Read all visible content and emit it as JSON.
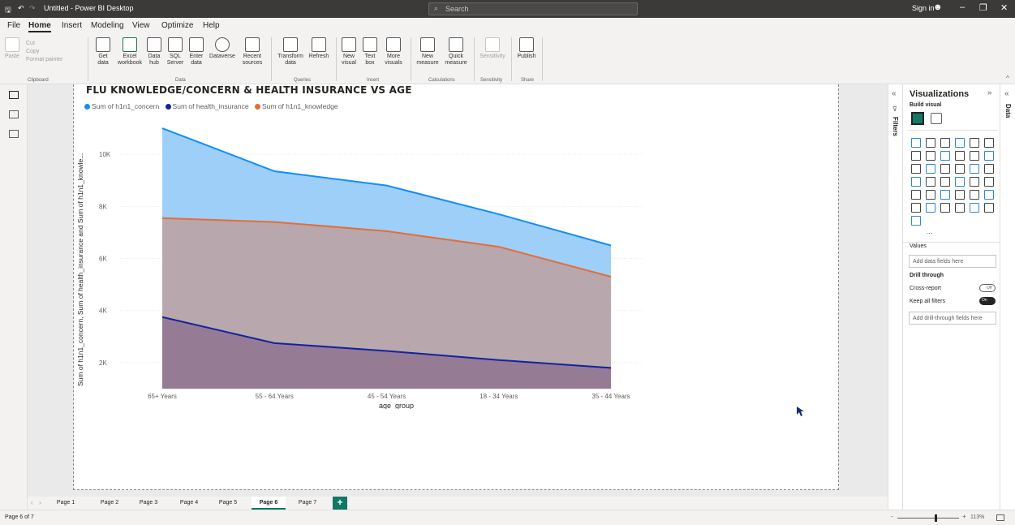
{
  "app": {
    "title": "Untitled - Power BI Desktop",
    "search_placeholder": "Search",
    "sign_in": "Sign in"
  },
  "menu": {
    "items": [
      "File",
      "Home",
      "Insert",
      "Modeling",
      "View",
      "Optimize",
      "Help"
    ],
    "active": "Home"
  },
  "ribbon": {
    "clipboard": {
      "paste": "Paste",
      "cut": "Cut",
      "copy": "Copy",
      "format_painter": "Format painter",
      "group": "Clipboard"
    },
    "data": {
      "buttons": [
        {
          "line1": "Get",
          "line2": "data"
        },
        {
          "line1": "Excel",
          "line2": "workbook"
        },
        {
          "line1": "Data",
          "line2": "hub"
        },
        {
          "line1": "SQL",
          "line2": "Server"
        },
        {
          "line1": "Enter",
          "line2": "data"
        },
        {
          "line1": "Dataverse",
          "line2": ""
        },
        {
          "line1": "Recent",
          "line2": "sources"
        }
      ],
      "group": "Data"
    },
    "queries": {
      "buttons": [
        {
          "line1": "Transform",
          "line2": "data"
        },
        {
          "line1": "Refresh",
          "line2": ""
        }
      ],
      "group": "Queries"
    },
    "insert": {
      "buttons": [
        {
          "line1": "New",
          "line2": "visual"
        },
        {
          "line1": "Text",
          "line2": "box"
        },
        {
          "line1": "More",
          "line2": "visuals"
        }
      ],
      "group": "Insert"
    },
    "calculations": {
      "buttons": [
        {
          "line1": "New",
          "line2": "measure"
        },
        {
          "line1": "Quick",
          "line2": "measure"
        }
      ],
      "group": "Calculations"
    },
    "sensitivity": {
      "buttons": [
        {
          "line1": "Sensitivity",
          "line2": ""
        }
      ],
      "group": "Sensitivity"
    },
    "share": {
      "buttons": [
        {
          "line1": "Publish",
          "line2": ""
        }
      ],
      "group": "Share"
    }
  },
  "panes": {
    "filters_label": "Filters",
    "data_label": "Data",
    "visualizations_title": "Visualizations",
    "build_visual": "Build visual",
    "values_label": "Values",
    "values_placeholder": "Add data fields here",
    "drill_through_label": "Drill through",
    "cross_report_label": "Cross-report",
    "cross_report_state": "Off",
    "keep_all_filters_label": "Keep all filters",
    "keep_all_filters_state": "On",
    "drill_placeholder": "Add drill-through fields here",
    "more_visuals": "···"
  },
  "pages": {
    "tabs": [
      "Page 1",
      "Page 2",
      "Page 3",
      "Page 4",
      "Page 5",
      "Page 6",
      "Page 7"
    ],
    "active": "Page 6",
    "add": "+"
  },
  "status": {
    "page_info": "Page 6 of 7",
    "zoom": "113%"
  },
  "chart_data": {
    "type": "area",
    "title": "FLU KNOWLEDGE/CONCERN & HEALTH INSURANCE VS AGE",
    "xlabel": "age_group",
    "ylabel": "Sum of h1n1_concern, Sum of health_insurance and Sum of h1n1_knowle...",
    "categories": [
      "65+ Years",
      "55 - 64 Years",
      "45 - 54 Years",
      "18 - 34 Years",
      "35 - 44 Years"
    ],
    "series": [
      {
        "name": "Sum of h1n1_concern",
        "color": "#118dff",
        "fill": "#9ecff9",
        "values": [
          11000,
          9350,
          8800,
          7700,
          6500
        ]
      },
      {
        "name": "Sum of health_insurance",
        "color": "#12239e",
        "fill": "#967b95",
        "values": [
          3750,
          2750,
          2450,
          2100,
          1800
        ]
      },
      {
        "name": "Sum of h1n1_knowledge",
        "color": "#e66c37",
        "fill": "#b8a7ac",
        "values": [
          7550,
          7400,
          7050,
          6450,
          5300
        ]
      }
    ],
    "y_ticks": [
      "2K",
      "4K",
      "6K",
      "8K",
      "10K"
    ],
    "ylim": [
      1000,
      11500
    ],
    "legend_position": "top-left"
  }
}
